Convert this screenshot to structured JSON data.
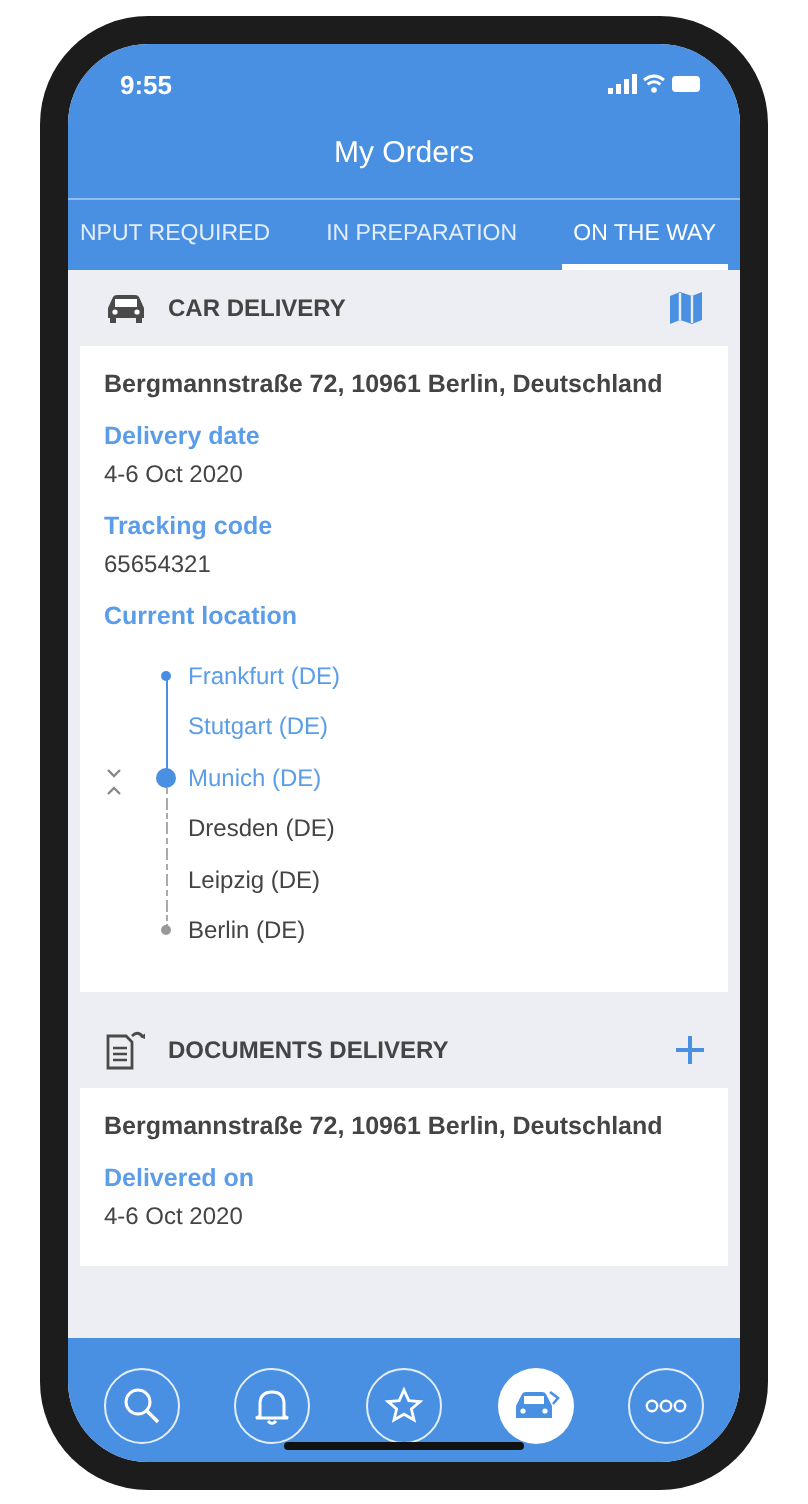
{
  "status_bar": {
    "time": "9:55"
  },
  "title": "My Orders",
  "tabs": [
    {
      "label": "NPUT REQUIRED",
      "selected": false
    },
    {
      "label": "IN PREPARATION",
      "selected": false
    },
    {
      "label": "ON THE WAY",
      "selected": true
    }
  ],
  "sections": [
    {
      "kind": "car",
      "title": "CAR DELIVERY",
      "items": [
        {
          "kind": "address",
          "text": "Bergmannstraße 72, 10961 Berlin, Deutschland"
        },
        {
          "kind": "field",
          "label": "Delivery date",
          "value": "4-6 Oct 2020"
        },
        {
          "kind": "field",
          "label": "Tracking code",
          "value": "65654321"
        },
        {
          "kind": "timeline",
          "label": "Current location",
          "stops": [
            {
              "name": "Frankfurt (DE)",
              "reached": true,
              "current": false
            },
            {
              "name": "Stutgart (DE)",
              "reached": true,
              "current": false
            },
            {
              "name": "Munich (DE)",
              "reached": true,
              "current": true
            },
            {
              "name": "Dresden (DE)",
              "reached": false,
              "current": false
            },
            {
              "name": "Leipzig (DE)",
              "reached": false,
              "current": false
            },
            {
              "name": "Berlin (DE)",
              "reached": false,
              "current": false
            }
          ]
        }
      ]
    },
    {
      "kind": "documents",
      "title": "DOCUMENTS DELIVERY",
      "items": [
        {
          "kind": "address",
          "text": "Bergmannstraße 72, 10961 Berlin, Deutschland"
        },
        {
          "kind": "field",
          "label": "Delivered on",
          "value": "4-6 Oct 2020"
        }
      ]
    }
  ],
  "nav": [
    {
      "kind": "search",
      "selected": false
    },
    {
      "kind": "bell",
      "selected": false
    },
    {
      "kind": "star",
      "selected": false
    },
    {
      "kind": "car",
      "selected": true
    },
    {
      "kind": "more",
      "selected": false
    }
  ]
}
